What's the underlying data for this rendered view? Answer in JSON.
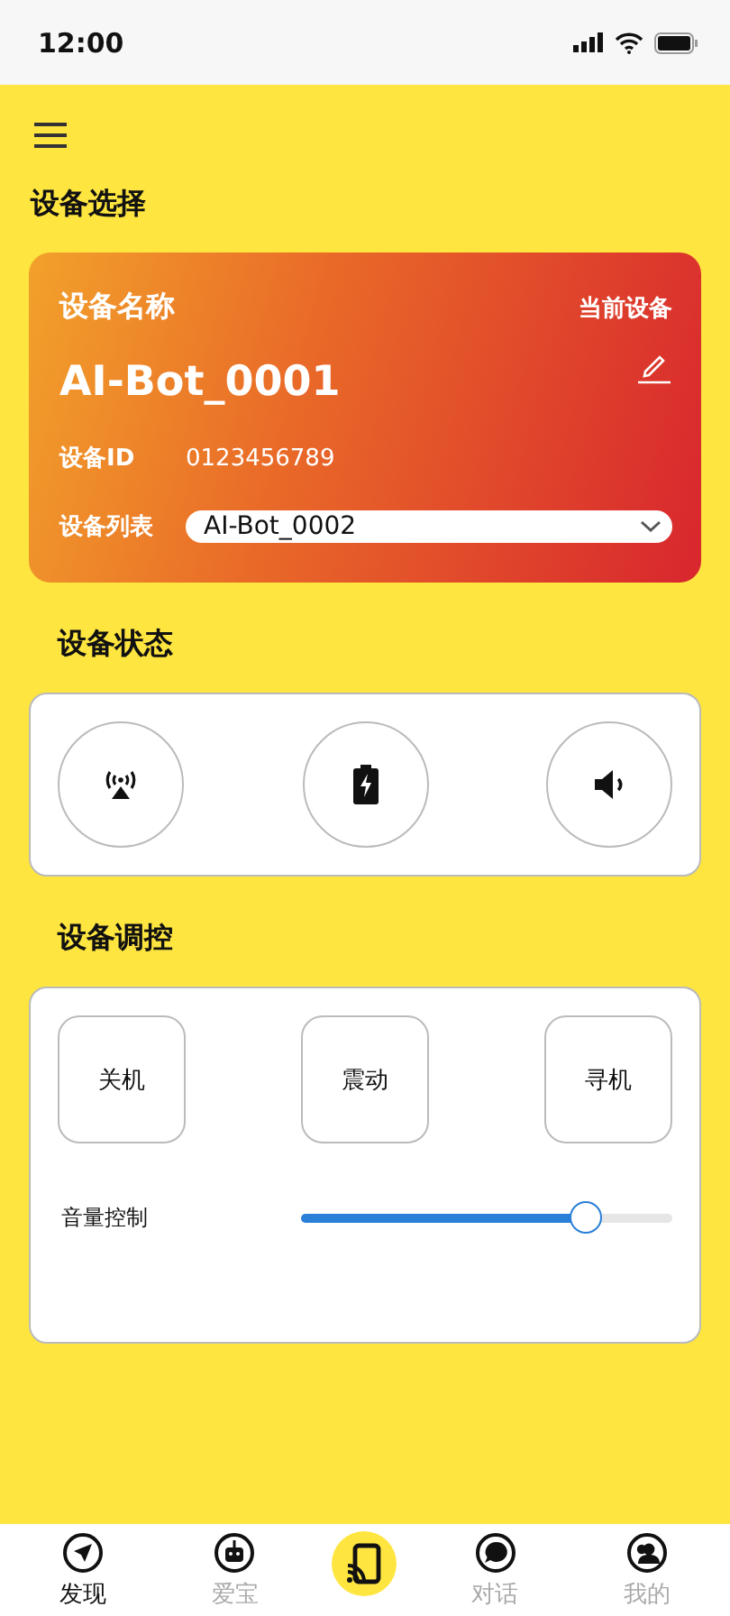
{
  "status_bar": {
    "time": "12:00"
  },
  "sections": [
    {
      "title": "设备选择"
    },
    {
      "title": "设备状态"
    },
    {
      "title": "设备调控"
    }
  ],
  "device_card": {
    "heading": "设备名称",
    "badge": "当前设备",
    "name": "AI-Bot_0001",
    "id_label": "设备ID",
    "id_value": "0123456789",
    "list_label": "设备列表",
    "list_value": "AI-Bot_0002"
  },
  "controls": [
    "关机",
    "震动",
    "寻机"
  ],
  "volume": {
    "label": "音量控制",
    "level": 0.79
  },
  "nav": [
    {
      "label": "发现",
      "selected": true
    },
    {
      "label": "爱宝",
      "selected": false
    },
    {
      "label": "对话",
      "selected": false
    },
    {
      "label": "我的",
      "selected": false
    }
  ]
}
